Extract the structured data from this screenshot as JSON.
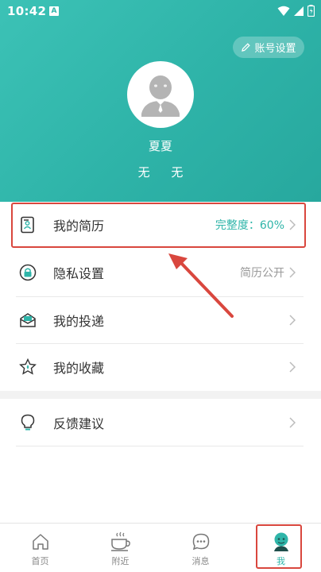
{
  "status_bar": {
    "time": "10:42",
    "notification_icon": "A"
  },
  "header": {
    "account_settings_label": "账号设置",
    "username": "夏夏",
    "info_left": "无",
    "info_right": "无"
  },
  "menu": {
    "items": [
      {
        "label": "我的简历",
        "value": "完整度：60%",
        "icon": "resume-icon"
      },
      {
        "label": "隐私设置",
        "value": "简历公开",
        "icon": "privacy-lock-icon"
      },
      {
        "label": "我的投递",
        "value": "",
        "icon": "envelope-icon"
      },
      {
        "label": "我的收藏",
        "value": "",
        "icon": "star-icon"
      },
      {
        "label": "反馈建议",
        "value": "",
        "icon": "lightbulb-icon"
      }
    ]
  },
  "tabbar": {
    "tabs": [
      {
        "label": "首页",
        "icon": "home-icon"
      },
      {
        "label": "附近",
        "icon": "coffee-cup-icon"
      },
      {
        "label": "消息",
        "icon": "chat-bubble-icon"
      },
      {
        "label": "我",
        "icon": "profile-icon"
      }
    ],
    "active_index": 3
  },
  "colors": {
    "accent": "#2fb5a9",
    "highlight": "#d9473e",
    "value_accent": "#2fb5a9"
  }
}
